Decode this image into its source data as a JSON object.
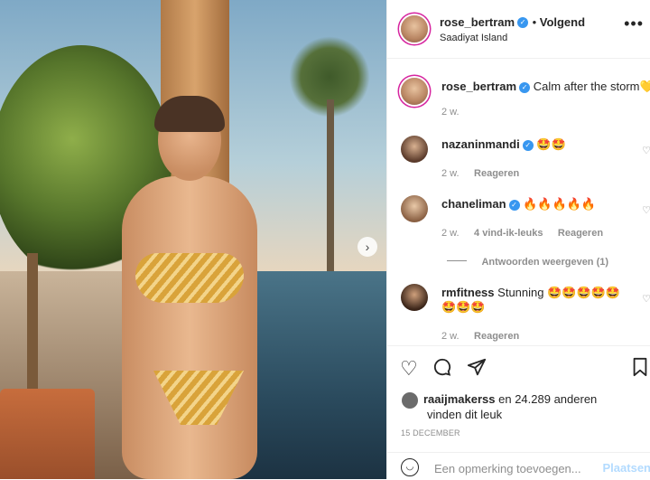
{
  "post": {
    "username": "rose_bertram",
    "follow_state": "Volgend",
    "location": "Saadiyat Island",
    "caption": "Calm after the storm💛",
    "caption_time": "2 w."
  },
  "comments": [
    {
      "user": "nazaninmandi",
      "verified": true,
      "text": "🤩🤩",
      "time": "2 w.",
      "reply": "Reageren",
      "likes": ""
    },
    {
      "user": "chaneliman",
      "verified": true,
      "text": "🔥🔥🔥🔥🔥",
      "time": "2 w.",
      "reply": "Reageren",
      "likes": "4 vind-ik-leuks"
    },
    {
      "user": "rmfitness",
      "verified": false,
      "text": "Stunning 🤩🤩🤩🤩🤩",
      "text2": "🤩🤩🤩",
      "time": "2 w.",
      "reply": "Reageren",
      "likes": ""
    }
  ],
  "view_replies": "Antwoorden weergeven (1)",
  "likes": {
    "user": "raaijmakerss",
    "rest": " en 24.289 anderen",
    "line2": "vinden dit leuk"
  },
  "date": "15 DECEMBER",
  "comment_box": {
    "placeholder": "Een opmerking toevoegen...",
    "post_label": "Plaatsen"
  },
  "icons": {
    "like": "heart-icon",
    "comment": "comment-icon",
    "share": "share-icon",
    "save": "bookmark-icon",
    "more": "more-icon",
    "emoji": "emoji-icon"
  },
  "colors": {
    "verified": "#3897f0",
    "story_ring": "#d6249f",
    "post_button": "#b3dbff"
  }
}
